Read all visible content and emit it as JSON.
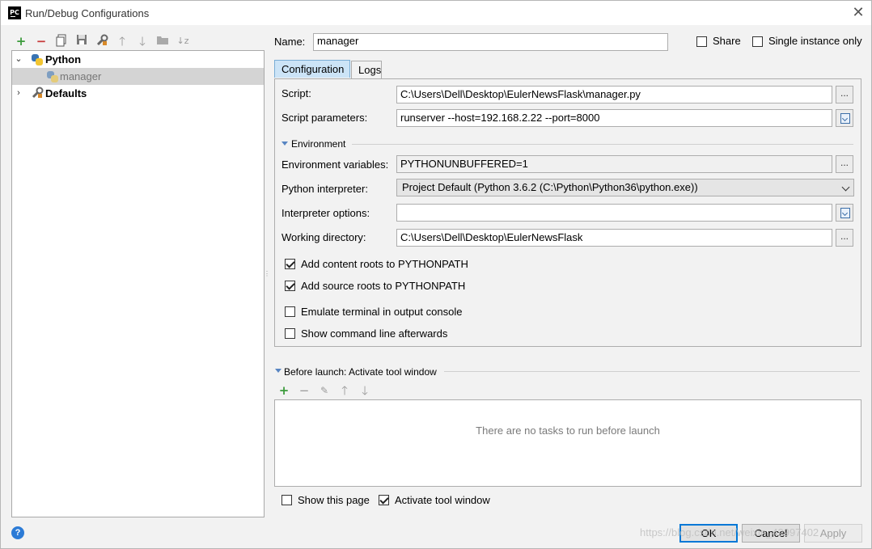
{
  "window": {
    "title": "Run/Debug Configurations",
    "app_icon": "PC"
  },
  "toolbar": {
    "icons": [
      "add-icon",
      "remove-icon",
      "copy-icon",
      "save-icon",
      "edit-defaults-icon",
      "move-up-icon",
      "move-down-icon",
      "folder-icon",
      "sort-icon"
    ]
  },
  "tree": {
    "python": "Python",
    "manager": "manager",
    "defaults": "Defaults"
  },
  "name": {
    "label": "Name:",
    "value": "manager"
  },
  "share_label": "Share",
  "single_instance_label": "Single instance only",
  "tabs": {
    "configuration": "Configuration",
    "logs": "Logs"
  },
  "config": {
    "script_label": "Script:",
    "script_value": "C:\\Users\\Dell\\Desktop\\EulerNewsFlask\\manager.py",
    "params_label": "Script parameters:",
    "params_value": "runserver --host=192.168.2.22 --port=8000",
    "environment_label": "Environment",
    "env_vars_label": "Environment variables:",
    "env_vars_value": "PYTHONUNBUFFERED=1",
    "interpreter_label": "Python interpreter:",
    "interpreter_value": "Project Default (Python 3.6.2 (C:\\Python\\Python36\\python.exe))",
    "interp_options_label": "Interpreter options:",
    "interp_options_value": "",
    "workdir_label": "Working directory:",
    "workdir_value": "C:\\Users\\Dell\\Desktop\\EulerNewsFlask",
    "add_content_roots": "Add content roots to PYTHONPATH",
    "add_source_roots": "Add source roots to PYTHONPATH",
    "emulate_terminal": "Emulate terminal in output console",
    "show_cmdline": "Show command line afterwards",
    "dots": "..."
  },
  "before_launch": {
    "label": "Before launch: Activate tool window",
    "empty": "There are no tasks to run before launch",
    "show_page": "Show this page",
    "activate_tool": "Activate tool window"
  },
  "buttons": {
    "ok": "OK",
    "cancel": "Cancel",
    "apply": "Apply"
  },
  "help": "?",
  "watermark": "https://blog.csdn.net/weixin_42997402"
}
